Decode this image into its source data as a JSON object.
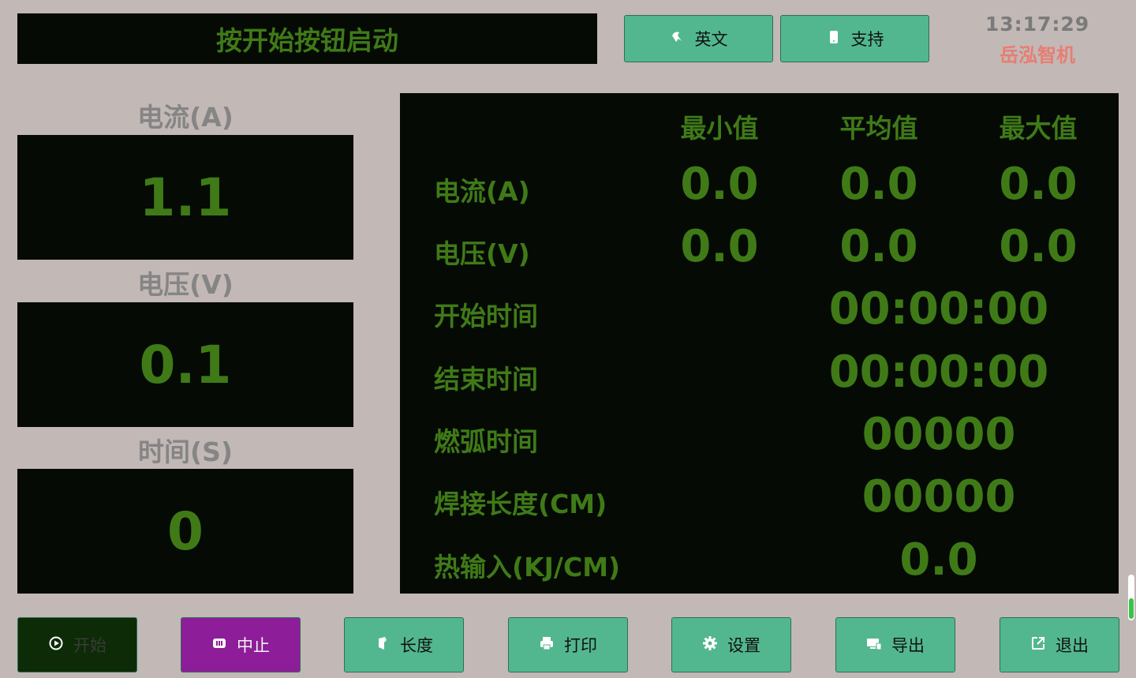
{
  "header": {
    "status": "按开始按钮启动",
    "buttons": [
      {
        "label": "英文",
        "icon": "language-icon"
      },
      {
        "label": "支持",
        "icon": "phone-icon"
      }
    ],
    "clock": "13:17:29",
    "brand": "岳泓智机"
  },
  "gauges": [
    {
      "label": "电流(A)",
      "value": "1.1"
    },
    {
      "label": "电压(V)",
      "value": "0.1"
    },
    {
      "label": "时间(S)",
      "value": "0"
    }
  ],
  "stats": {
    "columns": [
      "最小值",
      "平均值",
      "最大值"
    ],
    "rows": [
      {
        "label": "电流(A)",
        "min": "0.0",
        "avg": "0.0",
        "max": "0.0"
      },
      {
        "label": "电压(V)",
        "min": "0.0",
        "avg": "0.0",
        "max": "0.0"
      }
    ],
    "single_rows": [
      {
        "label": "开始时间",
        "value": "00:00:00"
      },
      {
        "label": "结束时间",
        "value": "00:00:00"
      },
      {
        "label": "燃弧时间",
        "value": "00000"
      },
      {
        "label": "焊接长度(CM)",
        "value": "00000"
      },
      {
        "label": "热输入(KJ/CM)",
        "value": "0.0"
      }
    ]
  },
  "footer": {
    "buttons": [
      {
        "label": "开始",
        "icon": "play-circle-icon"
      },
      {
        "label": "中止",
        "icon": "pause-icon"
      },
      {
        "label": "长度",
        "icon": "ruler-icon"
      },
      {
        "label": "打印",
        "icon": "printer-icon"
      },
      {
        "label": "设置",
        "icon": "gear-icon"
      },
      {
        "label": "导出",
        "icon": "export-icon"
      },
      {
        "label": "退出",
        "icon": "exit-icon"
      }
    ]
  },
  "colors": {
    "background": "#c2b8b6",
    "panel": "#050a05",
    "value_green": "#3f7a17",
    "button_teal": "#52b78f",
    "stop_purple": "#8e1d99",
    "brand_red": "#e87d72"
  }
}
